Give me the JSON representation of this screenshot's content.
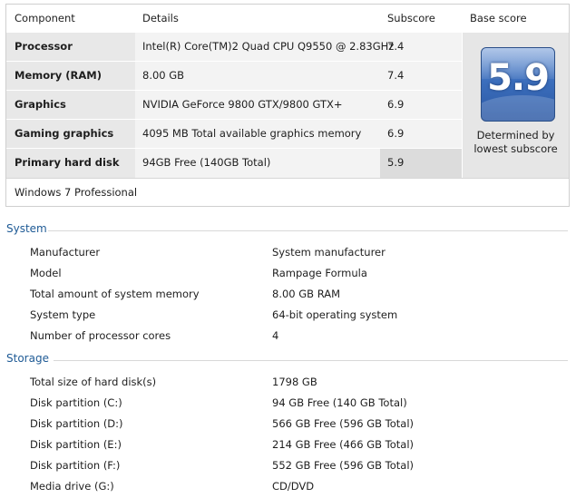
{
  "header": {
    "component": "Component",
    "details": "Details",
    "subscore": "Subscore",
    "base_score": "Base score"
  },
  "components": [
    {
      "label": "Processor",
      "details": "Intel(R) Core(TM)2 Quad CPU Q9550 @ 2.83GHz",
      "subscore": "7.4"
    },
    {
      "label": "Memory (RAM)",
      "details": "8.00 GB",
      "subscore": "7.4"
    },
    {
      "label": "Graphics",
      "details": "NVIDIA GeForce 9800 GTX/9800 GTX+",
      "subscore": "6.9"
    },
    {
      "label": "Gaming graphics",
      "details": "4095 MB Total available graphics memory",
      "subscore": "6.9"
    },
    {
      "label": "Primary hard disk",
      "details": "94GB Free (140GB Total)",
      "subscore": "5.9"
    }
  ],
  "base": {
    "score": "5.9",
    "caption_line1": "Determined by",
    "caption_line2": "lowest subscore"
  },
  "edition": "Windows 7 Professional",
  "system": {
    "title": "System",
    "rows": [
      {
        "key": "Manufacturer",
        "value": "System manufacturer"
      },
      {
        "key": "Model",
        "value": "Rampage Formula"
      },
      {
        "key": "Total amount of system memory",
        "value": "8.00 GB RAM"
      },
      {
        "key": "System type",
        "value": "64-bit operating system"
      },
      {
        "key": "Number of processor cores",
        "value": "4"
      }
    ]
  },
  "storage": {
    "title": "Storage",
    "rows": [
      {
        "key": "Total size of hard disk(s)",
        "value": "1798 GB"
      },
      {
        "key": "Disk partition (C:)",
        "value": "94 GB Free (140 GB Total)"
      },
      {
        "key": "Disk partition (D:)",
        "value": "566 GB Free (596 GB Total)"
      },
      {
        "key": "Disk partition (E:)",
        "value": "214 GB Free (466 GB Total)"
      },
      {
        "key": "Disk partition (F:)",
        "value": "552 GB Free (596 GB Total)"
      },
      {
        "key": "Media drive (G:)",
        "value": "CD/DVD"
      }
    ]
  },
  "colors": {
    "section_title": "#1e5a95",
    "badge": "#3c6fbd"
  }
}
